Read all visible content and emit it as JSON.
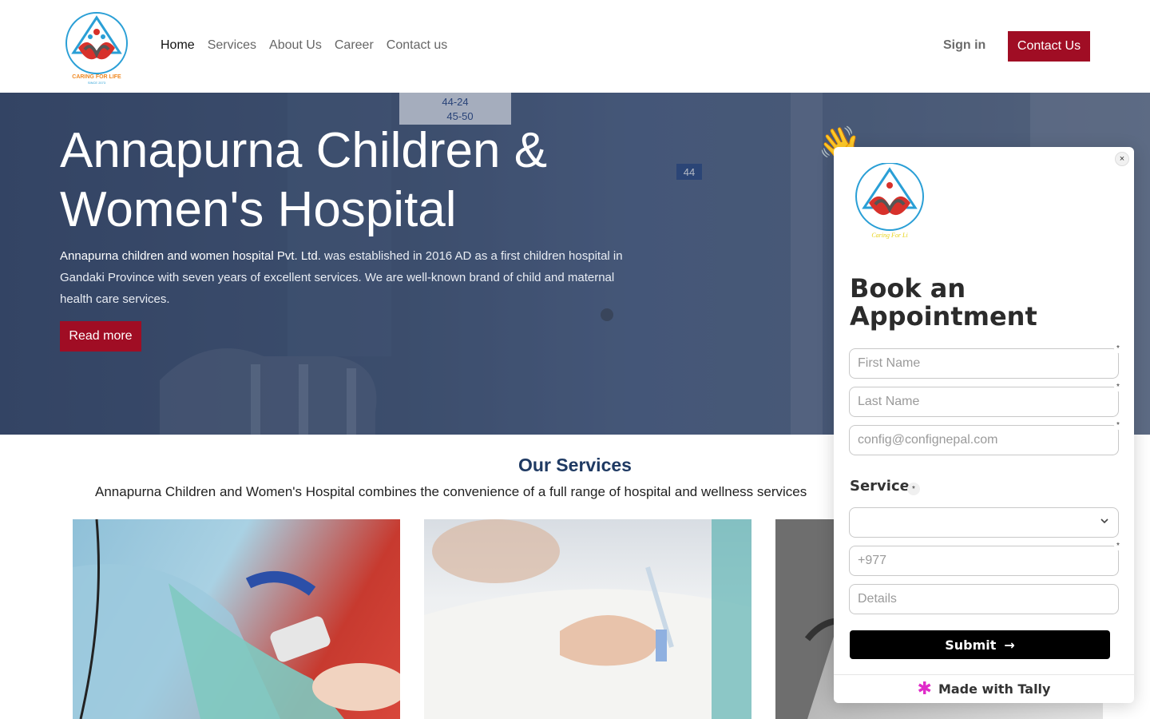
{
  "header": {
    "logo_caption": "CARING FOR LIFE",
    "logo_since": "SINCE 2073",
    "nav": [
      {
        "label": "Home"
      },
      {
        "label": "Services"
      },
      {
        "label": "About Us"
      },
      {
        "label": "Career"
      },
      {
        "label": "Contact us"
      }
    ],
    "signin_label": "Sign in",
    "contact_label": "Contact Us"
  },
  "hero": {
    "title": "Annapurna Children & Women's Hospital",
    "text_strong": "Annapurna children and women hospital Pvt. Ltd.",
    "text_rest": " was established in 2016 AD as a first children hospital in Gandaki Province with seven years of excellent services. We are well-known brand of child and maternal health care services.",
    "read_more_label": "Read more",
    "sign_top": "44-24",
    "sign_bottom": "45-50",
    "room_number": "44"
  },
  "services": {
    "title": "Our Services",
    "subtitle": "Annapurna Children and Women's Hospital combines the convenience of a full range of hospital and wellness services"
  },
  "popup": {
    "wave_emoji": "👋",
    "close_symbol": "×",
    "logo_caption": "Caring For Li",
    "title": "Book an Appointment",
    "fields": {
      "first_name_placeholder": "First Name",
      "last_name_placeholder": "Last Name",
      "email_placeholder": "config@confignepal.com",
      "phone_placeholder": "+977",
      "details_placeholder": "Details"
    },
    "service_label": "Service",
    "required_mark": "*",
    "select_value": "",
    "submit_label": "Submit",
    "submit_arrow": "→",
    "made_with_label": "Made with Tally"
  },
  "colors": {
    "brand_red": "#a00d24",
    "heading_blue": "#1f3a63",
    "tally_pink": "#e02cc9"
  }
}
